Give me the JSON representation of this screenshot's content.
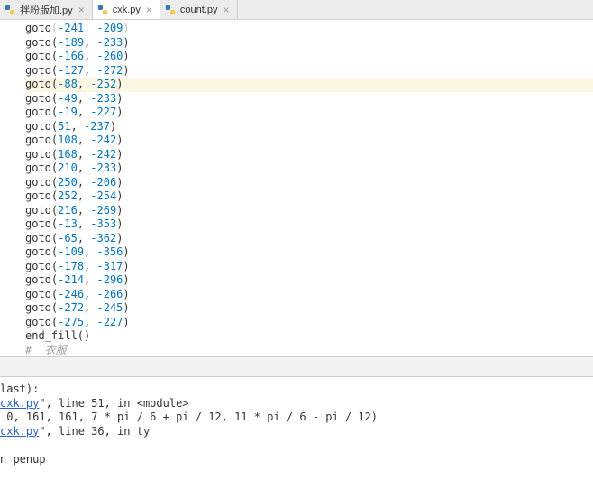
{
  "tabs": [
    {
      "label": "拌粉版加.py",
      "active": false
    },
    {
      "label": "cxk.py",
      "active": true
    },
    {
      "label": "count.py",
      "active": false
    }
  ],
  "code": {
    "lines": [
      {
        "fn": "goto",
        "a": "-241",
        "b": "-209",
        "hl": false,
        "dimmed": true
      },
      {
        "fn": "goto",
        "a": "-189",
        "b": "-233",
        "hl": false
      },
      {
        "fn": "goto",
        "a": "-166",
        "b": "-260",
        "hl": false
      },
      {
        "fn": "goto",
        "a": "-127",
        "b": "-272",
        "hl": false
      },
      {
        "fn": "goto",
        "a": "-88",
        "b": "-252",
        "hl": true
      },
      {
        "fn": "goto",
        "a": "-49",
        "b": "-233",
        "hl": false
      },
      {
        "fn": "goto",
        "a": "-19",
        "b": "-227",
        "hl": false
      },
      {
        "fn": "goto",
        "a": "51",
        "b": "-237",
        "hl": false
      },
      {
        "fn": "goto",
        "a": "108",
        "b": "-242",
        "hl": false
      },
      {
        "fn": "goto",
        "a": "168",
        "b": "-242",
        "hl": false
      },
      {
        "fn": "goto",
        "a": "210",
        "b": "-233",
        "hl": false
      },
      {
        "fn": "goto",
        "a": "250",
        "b": "-206",
        "hl": false
      },
      {
        "fn": "goto",
        "a": "252",
        "b": "-254",
        "hl": false
      },
      {
        "fn": "goto",
        "a": "216",
        "b": "-269",
        "hl": false
      },
      {
        "fn": "goto",
        "a": "-13",
        "b": "-353",
        "hl": false
      },
      {
        "fn": "goto",
        "a": "-65",
        "b": "-362",
        "hl": false
      },
      {
        "fn": "goto",
        "a": "-109",
        "b": "-356",
        "hl": false
      },
      {
        "fn": "goto",
        "a": "-178",
        "b": "-317",
        "hl": false
      },
      {
        "fn": "goto",
        "a": "-214",
        "b": "-296",
        "hl": false
      },
      {
        "fn": "goto",
        "a": "-246",
        "b": "-266",
        "hl": false
      },
      {
        "fn": "goto",
        "a": "-272",
        "b": "-245",
        "hl": false
      },
      {
        "fn": "goto",
        "a": "-275",
        "b": "-227",
        "hl": false
      }
    ],
    "endfill": "end_fill()",
    "comment": "#  衣服"
  },
  "console": {
    "l1": "last):",
    "link1": "cxk.py",
    "l2a": "\", line 51, in <module>",
    "l3": " 0, 161, 161, 7 * pi / 6 + pi / 12, 11 * pi / 6 - pi / 12)",
    "link2": "cxk.py",
    "l4a": "\", line 36, in ty",
    "l6": "n penup"
  }
}
